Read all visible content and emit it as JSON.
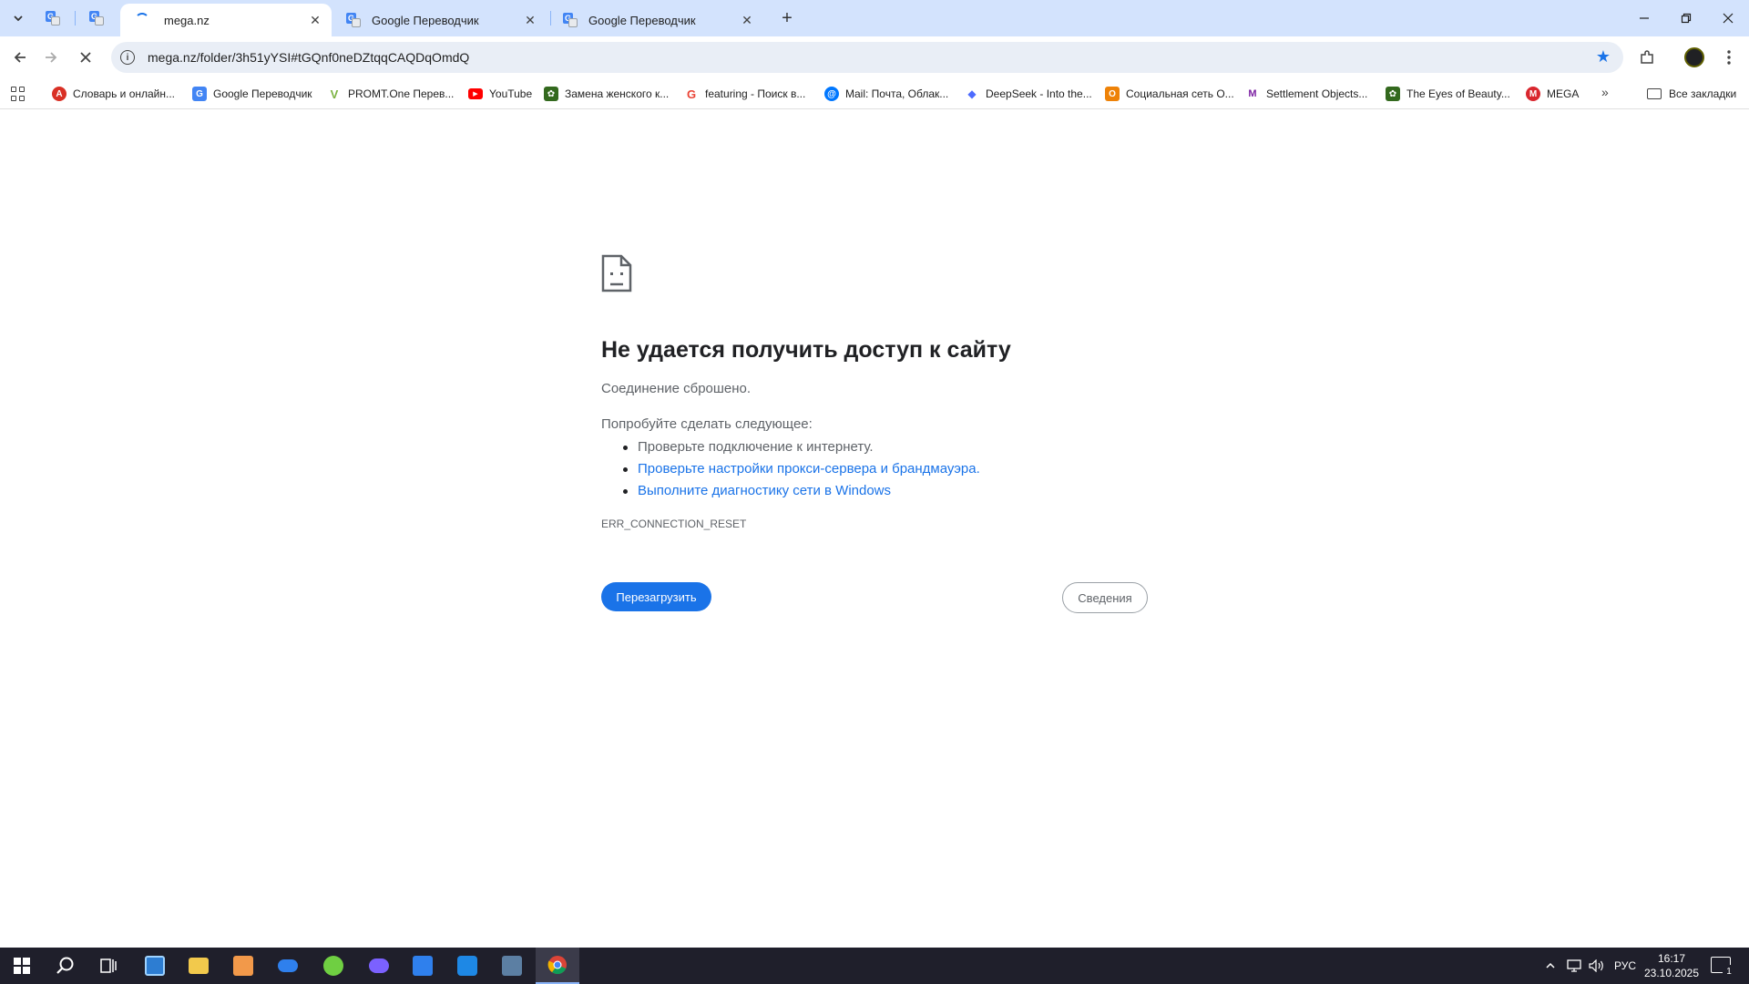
{
  "browser": {
    "tabs": [
      {
        "title": "mega.nz",
        "active": true
      },
      {
        "title": "Google Переводчик",
        "active": false
      },
      {
        "title": "Google Переводчик",
        "active": false
      }
    ],
    "url": "mega.nz/folder/3h51yYSI#tGQnf0neDZtqqCAQDqOmdQ",
    "bookmarks": [
      {
        "label": "Словарь и онлайн...",
        "color": "#d93025",
        "glyph": "A"
      },
      {
        "label": "Google Переводчик",
        "color": "#4285f4",
        "glyph": "G"
      },
      {
        "label": "PROMT.One Перев...",
        "color": "#7cb342",
        "glyph": "V"
      },
      {
        "label": "YouTube",
        "color": "#ff0000",
        "glyph": "▶"
      },
      {
        "label": "Замена женского к...",
        "color": "#33691e",
        "glyph": "✿"
      },
      {
        "label": "featuring - Поиск в...",
        "color": "#ea4335",
        "glyph": "G"
      },
      {
        "label": "Mail: Почта, Облак...",
        "color": "#0077ff",
        "glyph": "@"
      },
      {
        "label": "DeepSeek - Into the...",
        "color": "#4d6bfe",
        "glyph": "◆"
      },
      {
        "label": "Социальная сеть О...",
        "color": "#ee8208",
        "glyph": "O"
      },
      {
        "label": "Settlement Objects...",
        "color": "#7b1fa2",
        "glyph": "M"
      },
      {
        "label": "The Eyes of Beauty...",
        "color": "#33691e",
        "glyph": "✿"
      },
      {
        "label": "MEGA",
        "color": "#d9272e",
        "glyph": "M"
      }
    ],
    "all_bookmarks": "Все закладки"
  },
  "error_page": {
    "title": "Не удается получить доступ к сайту",
    "subtitle": "Соединение сброшено.",
    "try_label": "Попробуйте сделать следующее:",
    "suggestions": [
      {
        "text": "Проверьте подключение к интернету.",
        "link": false
      },
      {
        "text": "Проверьте настройки прокси-сервера и брандмауэра.",
        "link": true
      },
      {
        "text": "Выполните диагностику сети в Windows",
        "link": true
      }
    ],
    "error_code": "ERR_CONNECTION_RESET",
    "reload_label": "Перезагрузить",
    "details_label": "Сведения"
  },
  "taskbar": {
    "language": "РУС",
    "time": "16:17",
    "date": "23.10.2025",
    "notifications": "1"
  }
}
